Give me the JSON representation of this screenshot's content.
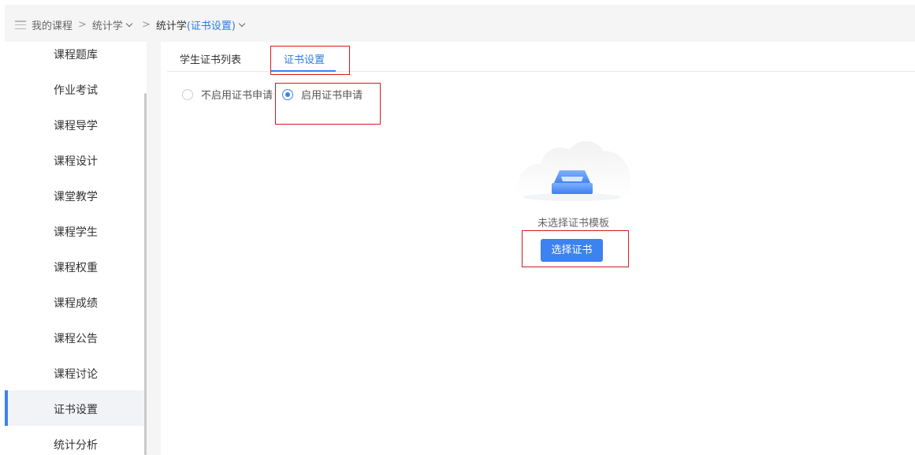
{
  "breadcrumb": {
    "home": "我的课程",
    "separator": ">",
    "course": "统计学",
    "current_prefix": "统计学",
    "current_highlight": "(证书设置)"
  },
  "sidebar": {
    "items": [
      {
        "label": "课程题库"
      },
      {
        "label": "作业考试"
      },
      {
        "label": "课程导学"
      },
      {
        "label": "课程设计"
      },
      {
        "label": "课堂教学"
      },
      {
        "label": "课程学生"
      },
      {
        "label": "课程权重"
      },
      {
        "label": "课程成绩"
      },
      {
        "label": "课程公告"
      },
      {
        "label": "课程讨论"
      },
      {
        "label": "证书设置",
        "active": true
      },
      {
        "label": "统计分析"
      }
    ]
  },
  "tabs": [
    {
      "label": "学生证书列表"
    },
    {
      "label": "证书设置",
      "active": true
    }
  ],
  "application": {
    "options": [
      {
        "label": "不启用证书申请",
        "checked": false
      },
      {
        "label": "启用证书申请",
        "checked": true
      }
    ]
  },
  "empty_state": {
    "message": "未选择证书模板",
    "icon": "empty-box-icon"
  },
  "actions": {
    "select_certificate": "选择证书"
  },
  "colors": {
    "accent": "#3c82f0",
    "annotation": "#d9191c"
  }
}
